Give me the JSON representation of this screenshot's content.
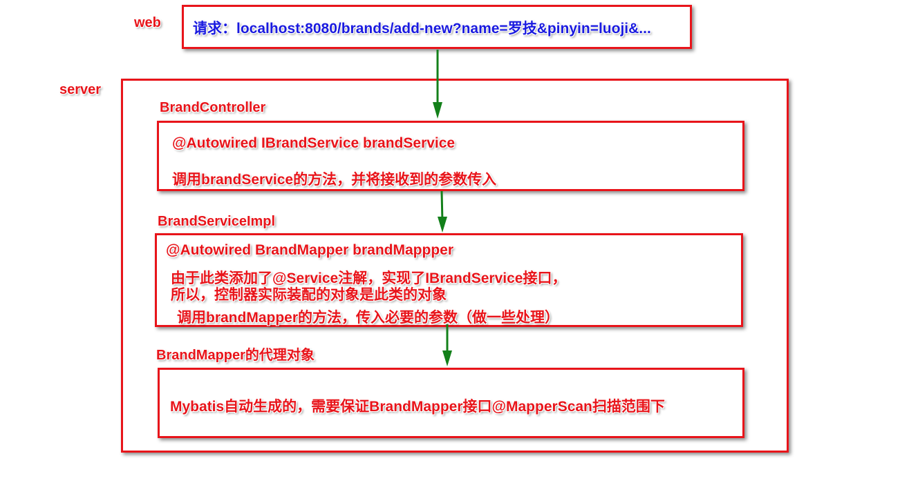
{
  "web": {
    "label": "web",
    "request": "请求：localhost:8080/brands/add-new?name=罗技&pinyin=luoji&..."
  },
  "server": {
    "label": "server",
    "controller": {
      "title": "BrandController",
      "line1": "@Autowired IBrandService brandService",
      "line2": "调用brandService的方法，并将接收到的参数传入"
    },
    "service_impl": {
      "title": "BrandServiceImpl",
      "line1": "@Autowired BrandMapper brandMappper",
      "line2": "由于此类添加了@Service注解，实现了IBrandService接口，",
      "line3": "所以，控制器实际装配的对象是此类的对象",
      "line4": "调用brandMapper的方法，传入必要的参数（做一些处理）"
    },
    "mapper_proxy": {
      "title": "BrandMapper的代理对象",
      "line1": "Mybatis自动生成的，需要保证BrandMapper接口@MapperScan扫描范围下"
    }
  },
  "colors": {
    "box_border": "#e8141a",
    "label_red": "#e8141a",
    "request_blue": "#1a1adf",
    "arrow_green": "#13801a"
  }
}
